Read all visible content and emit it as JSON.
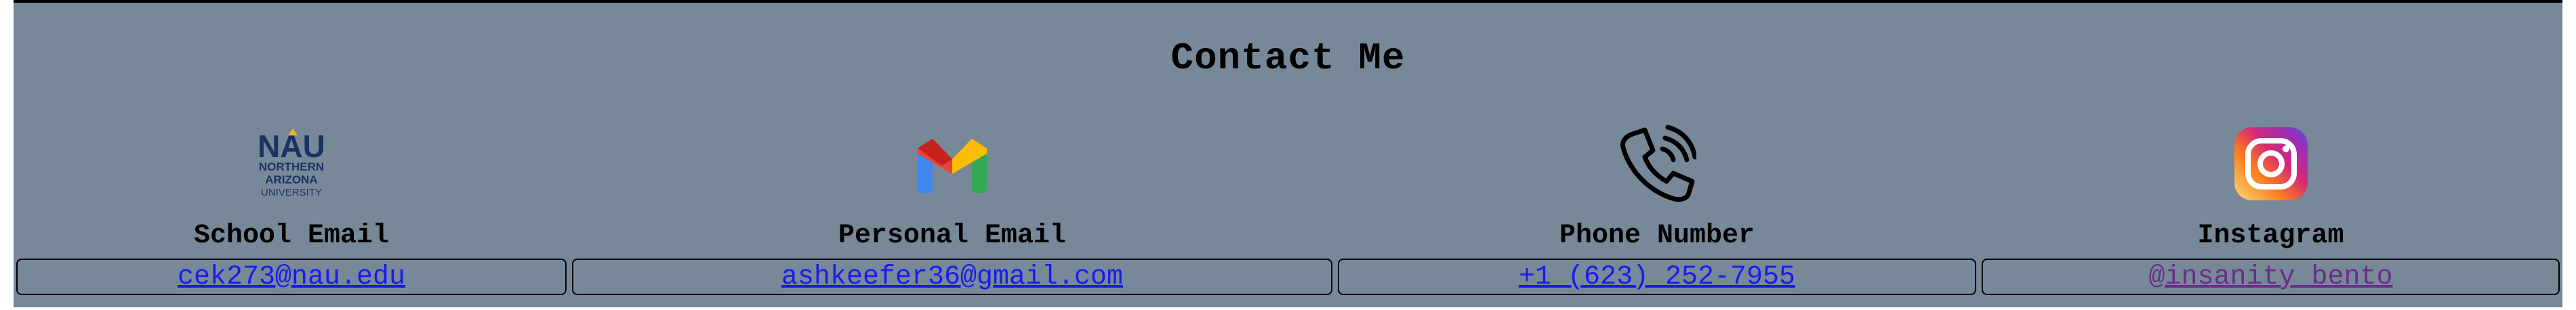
{
  "contact": {
    "title": "Contact Me",
    "items": [
      {
        "label": "School Email",
        "link_text": "cek273@nau.edu",
        "icon": "nau-logo-icon",
        "icon_text": [
          "NAU",
          "NORTHERN",
          "ARIZONA",
          "UNIVERSITY"
        ]
      },
      {
        "label": "Personal Email",
        "link_text": "ashkeefer36@gmail.com",
        "icon": "gmail-icon"
      },
      {
        "label": "Phone Number",
        "link_text": "+1 (623) 252-7955",
        "icon": "phone-icon"
      },
      {
        "label": "Instagram",
        "link_text": "@insanity_bento",
        "icon": "instagram-icon"
      }
    ]
  },
  "colors": {
    "background": "#778899",
    "link": "#1a1aee",
    "visited_link": "#6b2d8a",
    "nau_blue": "#1d3263",
    "nau_gold": "#f5b323"
  }
}
